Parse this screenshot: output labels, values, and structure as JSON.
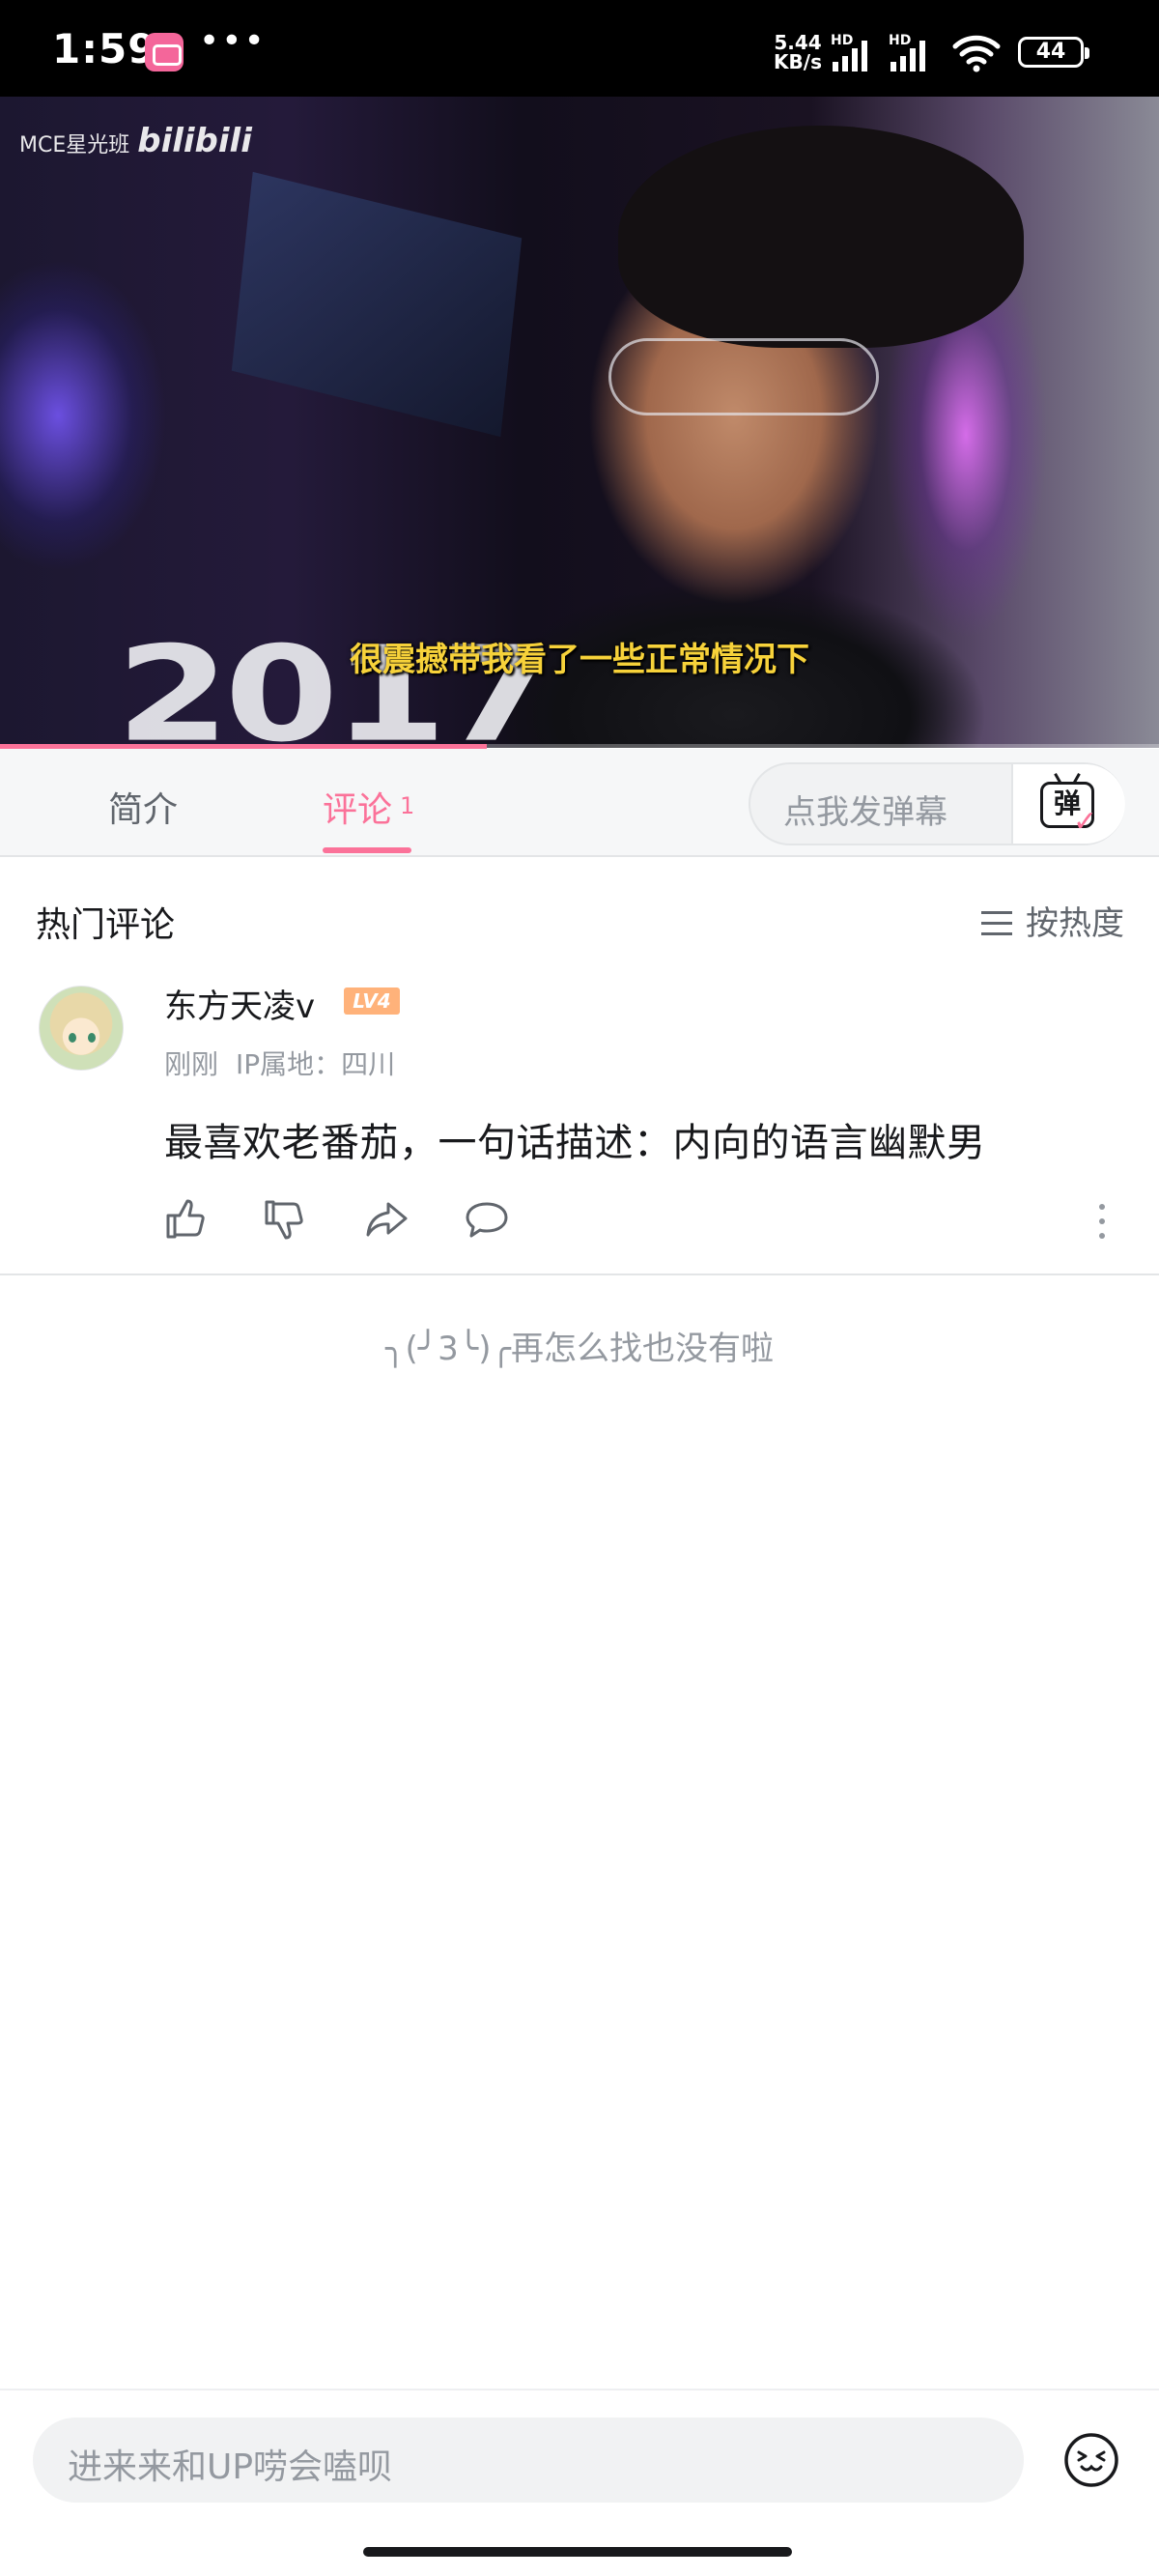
{
  "status_bar": {
    "time": "1:59",
    "net_speed_value": "5.44",
    "net_speed_unit": "KB/s",
    "hd1": "HD",
    "hd2": "HD",
    "battery": "44"
  },
  "video": {
    "watermark_text": "MCE星光班",
    "watermark_logo": "bilibili",
    "subtitle": "很震撼带我看了一些正常情况下",
    "progress_fraction": 0.42
  },
  "tabs": {
    "intro_label": "简介",
    "comments_label": "评论",
    "comments_count": "1"
  },
  "danmaku": {
    "placeholder": "点我发弹幕",
    "button_glyph": "弹"
  },
  "comments_section": {
    "title": "热门评论",
    "sort_label": "按热度",
    "comments": [
      {
        "username": "东方天凌v",
        "level": "LV4",
        "time": "刚刚",
        "ip": "IP属地：四川",
        "text": "最喜欢老番茄，一句话描述：内向的语言幽默男"
      }
    ],
    "end_message": "╮(╯3╰)╭再怎么找也没有啦"
  },
  "reply": {
    "placeholder": "进来来和UP唠会嗑呗"
  },
  "colors": {
    "accent": "#fb7299",
    "level_badge": "#ffb27a",
    "subtitle": "#f7d23a"
  },
  "icons": [
    "like-icon",
    "dislike-icon",
    "share-icon",
    "reply-icon",
    "more-icon",
    "emoji-icon",
    "sort-icon",
    "danmaku-tv-icon"
  ]
}
